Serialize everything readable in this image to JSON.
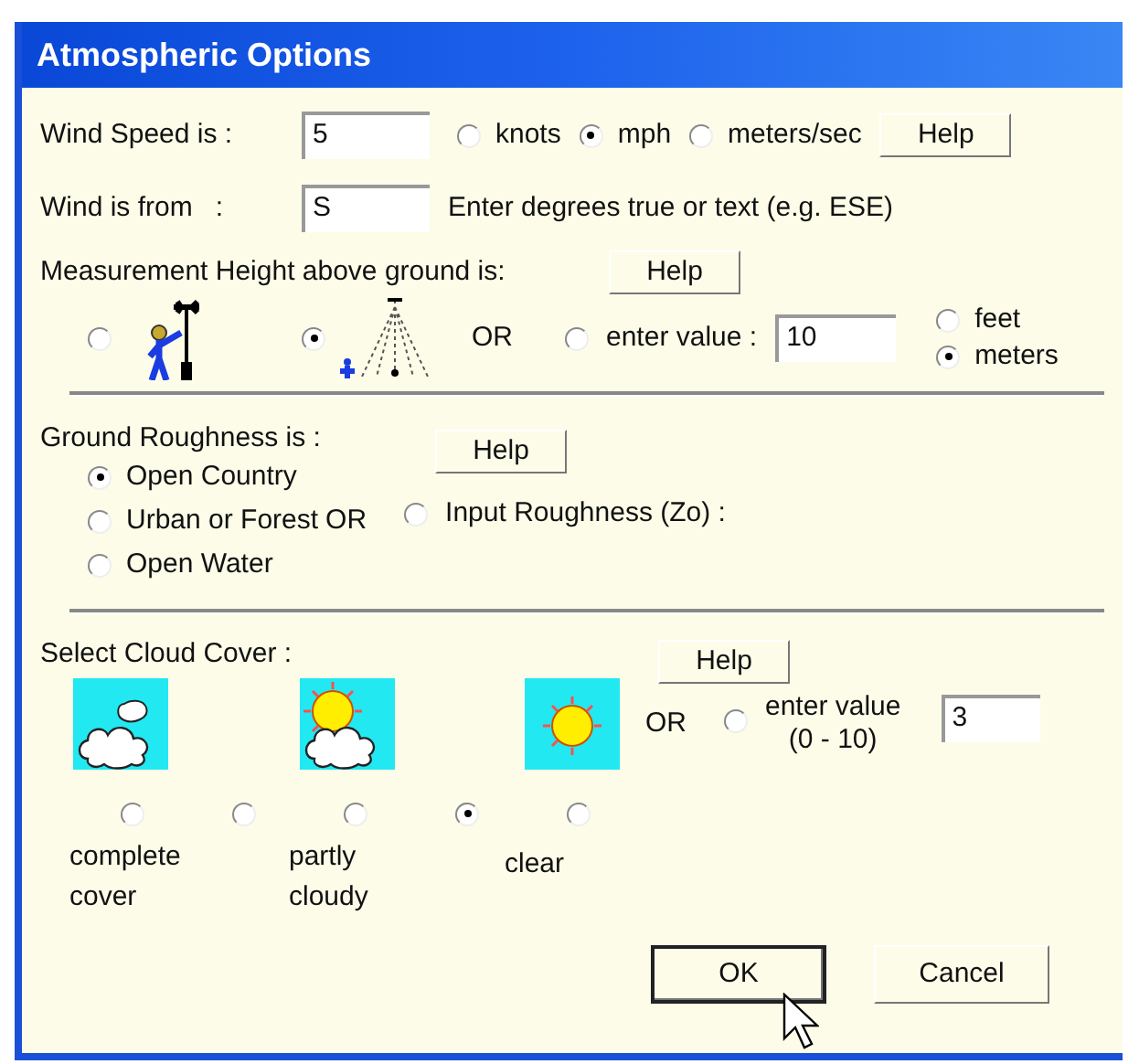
{
  "window": {
    "title": "Atmospheric Options"
  },
  "wind_speed": {
    "label": "Wind Speed is :",
    "value": "5",
    "units": [
      {
        "label": "knots",
        "selected": false
      },
      {
        "label": "mph",
        "selected": true
      },
      {
        "label": "meters/sec",
        "selected": false
      }
    ],
    "help": "Help"
  },
  "wind_direction": {
    "label": "Wind is from   :",
    "value": "S",
    "hint": "Enter degrees true or text (e.g. ESE)"
  },
  "measurement_height": {
    "label": "Measurement Height above ground is:",
    "help": "Help",
    "options": [
      {
        "kind": "person",
        "selected": false
      },
      {
        "kind": "tower",
        "selected": true
      }
    ],
    "or": "OR",
    "custom": {
      "label": "enter value :",
      "selected": false,
      "value": "10"
    },
    "units": [
      {
        "label": "feet",
        "selected": false
      },
      {
        "label": "meters",
        "selected": true
      }
    ]
  },
  "ground_roughness": {
    "label": "Ground Roughness is :",
    "help": "Help",
    "options": [
      {
        "label": "Open Country",
        "selected": true
      },
      {
        "label": "Urban or Forest",
        "selected": false
      },
      {
        "label": "Open Water",
        "selected": false
      }
    ],
    "or": "OR",
    "custom": {
      "label": "Input Roughness (Zo) :",
      "selected": false
    }
  },
  "cloud_cover": {
    "label": "Select Cloud Cover :",
    "help": "Help",
    "pictures": [
      {
        "kind": "overcast"
      },
      {
        "kind": "partly"
      },
      {
        "kind": "clear"
      }
    ],
    "levels": [
      {
        "selected": false
      },
      {
        "selected": false
      },
      {
        "selected": false
      },
      {
        "selected": true
      },
      {
        "selected": false
      }
    ],
    "captions": [
      "complete cover",
      "partly cloudy",
      "clear"
    ],
    "or": "OR",
    "custom": {
      "label": "enter value",
      "range": "(0 - 10)",
      "selected": false,
      "value": "3"
    }
  },
  "buttons": [
    {
      "label": "OK",
      "focused": true
    },
    {
      "label": "Cancel",
      "focused": false
    }
  ]
}
